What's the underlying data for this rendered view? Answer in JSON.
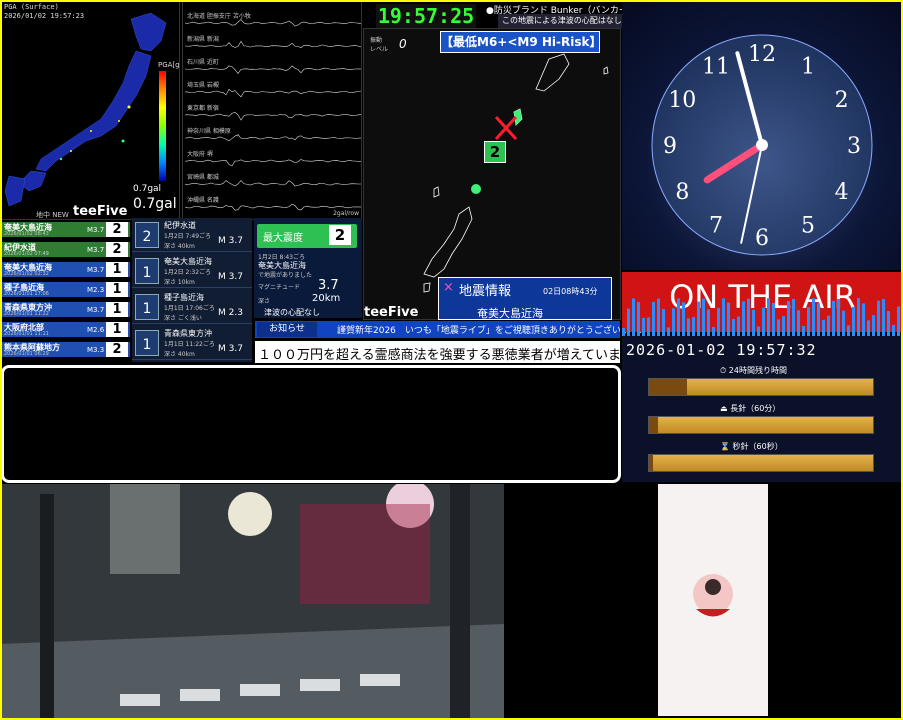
{
  "map_panel": {
    "pga_label": "PGA (Surface)",
    "timestamp": "2026/01/02 19:57:23",
    "scale_title": "PGA[gal]",
    "gal_value": "0.7gal",
    "gal_big": "0.7gal",
    "brand": "teeFive",
    "chika_label": "地中 NEW"
  },
  "seismograph": {
    "stations": [
      "北海道 胆振支庁 苫小牧",
      "新潟県 新潟",
      "石川県 近町",
      "埼玉県 岩槻",
      "東京都 新宿",
      "神奈川県 相模原",
      "大阪府 堺",
      "宮崎県 都城",
      "沖縄県 名護"
    ],
    "footer": "2gal/row"
  },
  "quake_list": [
    {
      "place": "奄美大島近海",
      "time": "2026/01/02 08:43",
      "mag": "M3.7",
      "intensity": "2",
      "color": "#2e7d32"
    },
    {
      "place": "紀伊水道",
      "time": "2026/01/02 07:49",
      "mag": "M3.7",
      "intensity": "2",
      "color": "#2e7d32"
    },
    {
      "place": "奄美大島近海",
      "time": "2026/01/02 02:32",
      "mag": "M3.7",
      "intensity": "1",
      "color": "#1f4fb0"
    },
    {
      "place": "種子島近海",
      "time": "2026/01/01 17:06",
      "mag": "M2.3",
      "intensity": "1",
      "color": "#1f4fb0"
    },
    {
      "place": "青森県東方沖",
      "time": "2026/01/01 11:22",
      "mag": "M3.7",
      "intensity": "1",
      "color": "#1f4fb0"
    },
    {
      "place": "大阪府北部",
      "time": "2026/01/01 11:11",
      "mag": "M2.6",
      "intensity": "1",
      "color": "#1f4fb0"
    },
    {
      "place": "熊本県阿蘇地方",
      "time": "2026/01/01 06:29",
      "mag": "M3.3",
      "intensity": "2",
      "color": "#1f4fb0"
    }
  ],
  "quake_detail": [
    {
      "place": "紀伊水道",
      "date": "1月2日 7:49ごろ",
      "depth": "深さ 40km",
      "mag": "M 3.7",
      "intensity": "2"
    },
    {
      "place": "奄美大島近海",
      "date": "1月2日 2:32ごろ",
      "depth": "深さ 10km",
      "mag": "M 3.7",
      "intensity": "1"
    },
    {
      "place": "種子島近海",
      "date": "1月1日 17:06ごろ",
      "depth": "深さ ごく浅い",
      "mag": "M 2.3",
      "intensity": "1"
    },
    {
      "place": "青森県東方沖",
      "date": "1月1日 11:22ごろ",
      "depth": "深さ 40km",
      "mag": "M 3.7",
      "intensity": "1"
    }
  ],
  "max_intensity": {
    "label": "最大震度",
    "value": "2",
    "date": "1月2日 8:43ごろ",
    "place": "奄美大島近海",
    "sub": "で地震がありました",
    "mag_label": "マグニチュード",
    "mag": "3.7",
    "depth_label": "深さ",
    "depth": "20km",
    "tsunami": "津波の心配なし"
  },
  "header": {
    "clock": "19:57:25",
    "bunker_title": "●防災ブランド Bunker（バンカー）",
    "tsunami_line": "この地震による津波の心配はなし"
  },
  "center_map": {
    "shindo_label": "振動\nレベル",
    "shindo_value": "0",
    "risk_text": "【最低M6+<M9 Hi-Risk】",
    "epicenter_intensity": "2",
    "brand": "teeFive",
    "info_icon": "×",
    "info_title": "地震情報",
    "info_time": "02日08時43分",
    "info_place": "奄美大島近海"
  },
  "notice": {
    "badge": "お知らせ",
    "text": "謹賀新年2026　いつも「地震ライブ」をご視聴頂きありがとうございます!",
    "ticker": "１００万円を超える霊感商法を強要する悪徳業者が増えています。ご注"
  },
  "clock_panel": {
    "numbers": [
      "12",
      "1",
      "2",
      "3",
      "4",
      "5",
      "6",
      "7",
      "8",
      "9",
      "10",
      "11"
    ],
    "on_air": "ON THE AIR",
    "datetime": "2026-01-02 19:57:32"
  },
  "progress": [
    {
      "icon": "⏱",
      "label": "24時間残り時間",
      "fraction": 0.17
    },
    {
      "icon": "⏏",
      "label": "長針（60分）",
      "fraction": 0.04
    },
    {
      "icon": "⌛",
      "label": "秒針（60秒）",
      "fraction": 0.02
    }
  ],
  "colors": {
    "green": "#2ec052",
    "blue": "#1044c0",
    "red": "#d01414",
    "yellow": "#ffff00"
  }
}
